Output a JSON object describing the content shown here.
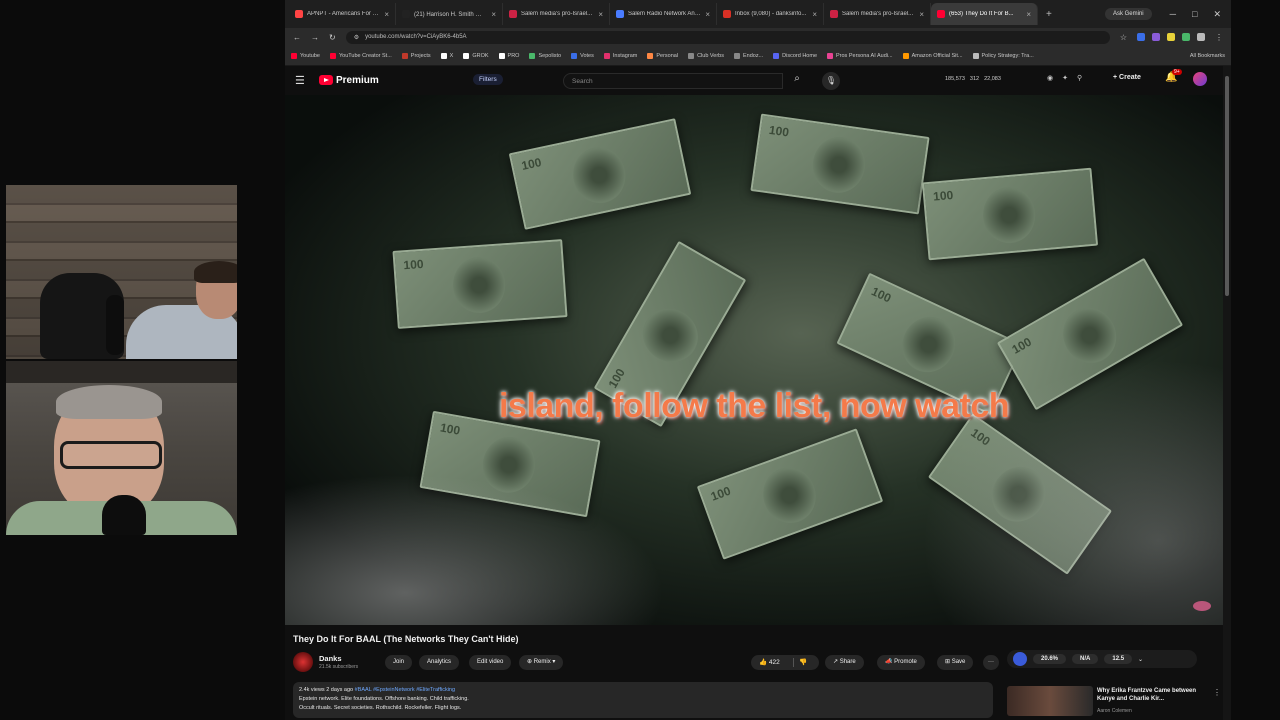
{
  "tabs": [
    {
      "label": "APNPT - Americans For H...",
      "color": "#ff4444"
    },
    {
      "label": "(21) Harrison H. Smith 👁...",
      "color": "#222222"
    },
    {
      "label": "Salem media's pro-Israel...",
      "color": "#cc2244"
    },
    {
      "label": "Salem Radio Network Ann...",
      "color": "#4a7cff"
    },
    {
      "label": "Inbox (9,080) - danksinfo...",
      "color": "#d93025"
    },
    {
      "label": "Salem media's pro-Israel...",
      "color": "#cc2244"
    },
    {
      "label": "(653) They Do It For B...",
      "color": "#ff0033"
    }
  ],
  "new_tab": "+",
  "ask_gemini": "Ask Gemini",
  "window_controls": [
    "─",
    "□",
    "✕"
  ],
  "address": {
    "url": "youtube.com/watch?v=CiAyBK6-4b5A"
  },
  "bookmarks": [
    "Youtube",
    "YouTube Creator St...",
    "Projects",
    "X",
    "GROK",
    "PRO",
    "Sepolisto",
    "Votes",
    "Instagram",
    "Personal",
    "Club Verbs",
    "Endoz...",
    "Discord Home",
    "Pros Persona AI Audi...",
    "Amazon Official Sit...",
    "Policy Strategy: Tra..."
  ],
  "all_bookmarks": "All Bookmarks",
  "yt": {
    "logo_text": "Premium",
    "filters": "Filters",
    "search_placeholder": "Search",
    "stats": [
      "185,573",
      "312",
      "22,083"
    ],
    "create": "Create",
    "notif_count": "9+"
  },
  "video": {
    "caption": "island, follow the list, now watch"
  },
  "meta": {
    "title": "They Do It For BAAL (The Networks They Can't Hide)",
    "channel": "Danks",
    "subscribers": "21.5k subscribers",
    "buttons": {
      "join": "Join",
      "analytics": "Analytics",
      "edit": "Edit video",
      "remix": "Remix",
      "likes": "422",
      "share": "Share",
      "promote": "Promote",
      "save": "Save",
      "more": "···"
    },
    "views_line": "2.4k views  2 days ago",
    "tags": "#BAAL #EpsteinNetwork #EliteTrafficking",
    "desc_line1": "Epstein network. Elite foundations. Offshore banking. Child trafficking.",
    "desc_line2": "Occult rituals. Secret societies. Rothschild. Rockefeller. Flight logs."
  },
  "extension": {
    "values": [
      "20.6%",
      "N/A",
      "12.5"
    ]
  },
  "recommended": {
    "title": "Why Erika Frantzve Came between Kanye and Charlie Kir...",
    "channel": "Aaron Colemen"
  }
}
